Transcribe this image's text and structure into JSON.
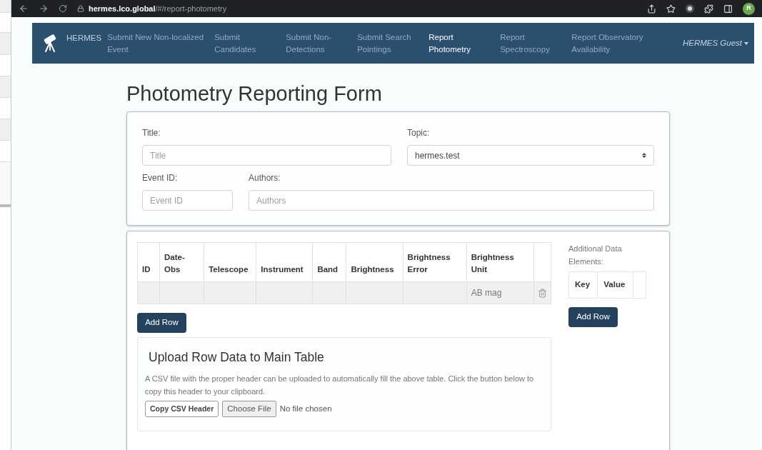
{
  "browser": {
    "url": "**hermes.lco.global**/#/report-photometry",
    "profile_initial": "R"
  },
  "navbar": {
    "brand": "HERMES",
    "items": [
      {
        "label": "Submit New Non-localized Event",
        "selected": false
      },
      {
        "label": "Submit Candidates",
        "selected": false
      },
      {
        "label": "Submit Non-Detections",
        "selected": false
      },
      {
        "label": "Submit Search Pointings",
        "selected": false
      },
      {
        "label": "Report Photometry",
        "selected": true
      },
      {
        "label": "Report Spectroscopy",
        "selected": false
      },
      {
        "label": "Report Observatory Availability",
        "selected": false
      }
    ],
    "user": "HERMES Guest"
  },
  "heading": "Photometry Reporting Form",
  "form": {
    "title": {
      "label": "Title:",
      "placeholder": "Title"
    },
    "topic": {
      "label": "Topic:",
      "value": "hermes.test"
    },
    "event_id": {
      "label": "Event ID:",
      "placeholder": "Event ID"
    },
    "authors": {
      "label": "Authors:",
      "placeholder": "Authors"
    }
  },
  "photometry_table": {
    "columns": [
      "ID",
      "Date-Obs",
      "Telescope",
      "Instrument",
      "Band",
      "Brightness",
      "Brightness Error",
      "Brightness Unit"
    ],
    "rows": [
      {
        "brightness_unit": "AB mag"
      }
    ],
    "add_button": "Add Row"
  },
  "additional_data": {
    "label": "Additional Data Elements:",
    "columns": [
      "Key",
      "Value"
    ],
    "add_button": "Add Row"
  },
  "upload": {
    "title": "Upload Row Data to Main Table",
    "description": "A CSV file with the proper header can be uploaded to automatically fill the above table. Click the button below to copy this header to your clipboard.",
    "copy_button": "Copy CSV Header",
    "file_button": "Choose File",
    "file_status": "No file chosen"
  }
}
